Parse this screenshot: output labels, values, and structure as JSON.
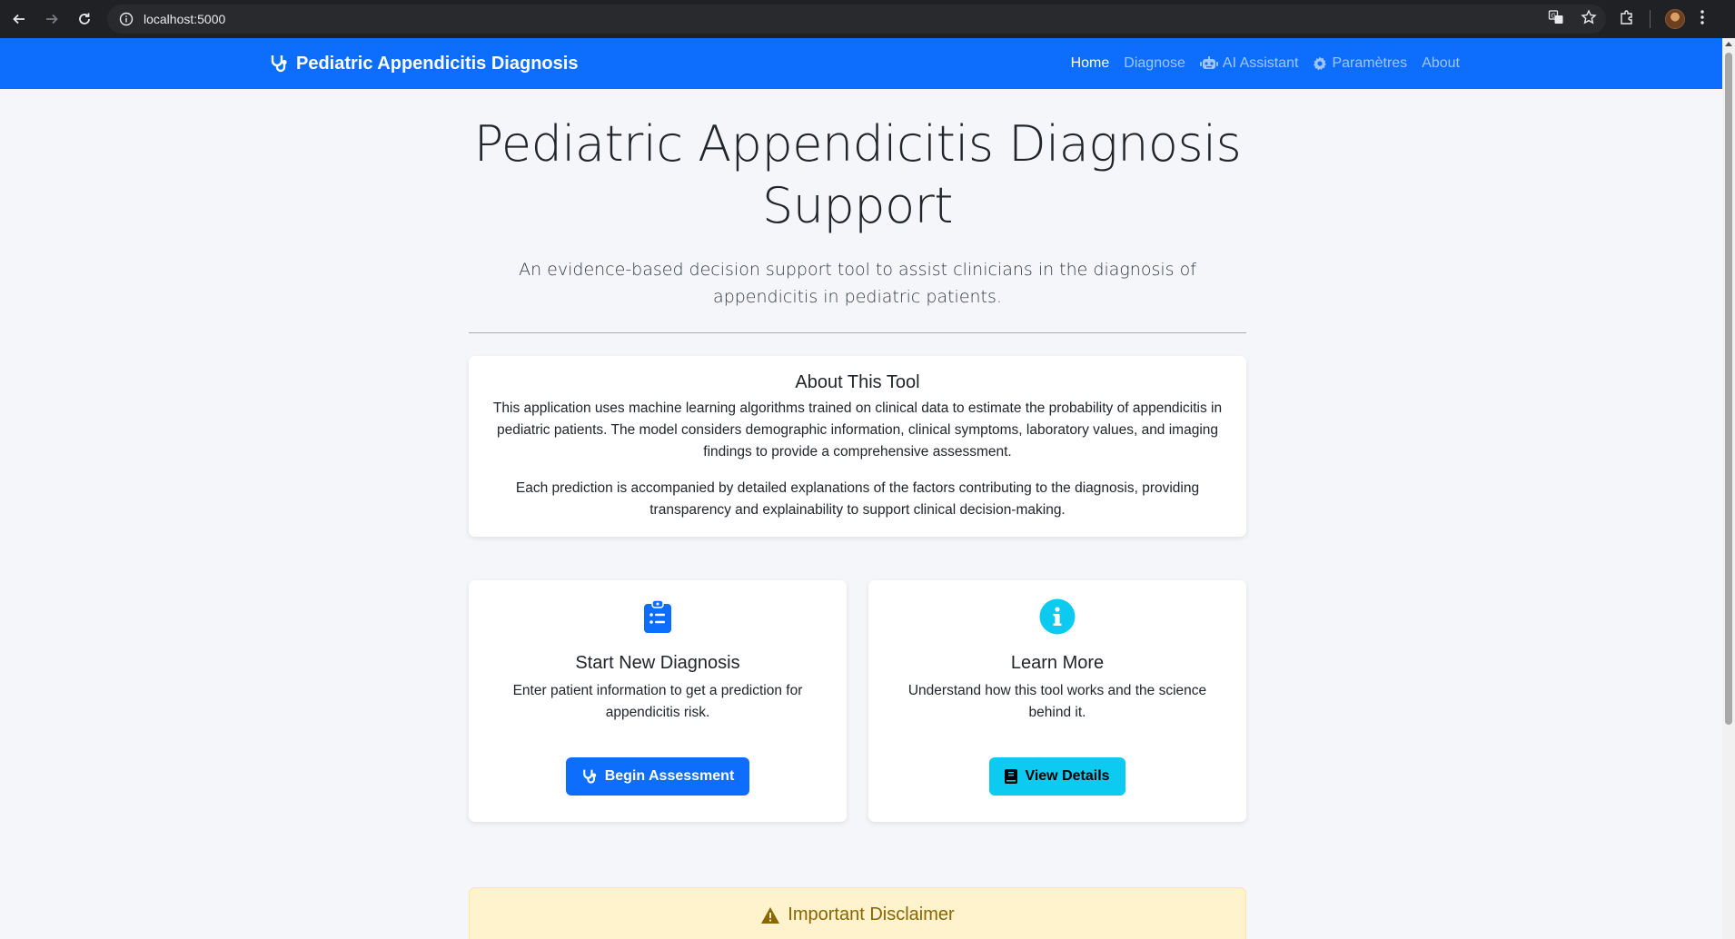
{
  "browser": {
    "url": "localhost:5000"
  },
  "navbar": {
    "brand": "Pediatric Appendicitis Diagnosis",
    "links": [
      {
        "label": "Home",
        "active": true
      },
      {
        "label": "Diagnose",
        "active": false
      },
      {
        "label": "AI Assistant",
        "icon": "robot-icon",
        "active": false
      },
      {
        "label": "Paramètres",
        "icon": "gear-icon",
        "active": false
      },
      {
        "label": "About",
        "active": false
      }
    ]
  },
  "hero": {
    "title_line1": "Pediatric Appendicitis Diagnosis",
    "title_line2": "Support",
    "lead": "An evidence-based decision support tool to assist clinicians in the diagnosis of appendicitis in pediatric patients."
  },
  "about": {
    "title": "About This Tool",
    "paragraph1": "This application uses machine learning algorithms trained on clinical data to estimate the probability of appendicitis in pediatric patients. The model considers demographic information, clinical symptoms, laboratory values, and imaging findings to provide a comprehensive assessment.",
    "paragraph2": "Each prediction is accompanied by detailed explanations of the factors contributing to the diagnosis, providing transparency and explainability to support clinical decision-making."
  },
  "cards": [
    {
      "icon": "clipboard-list-icon",
      "title": "Start New Diagnosis",
      "text": "Enter patient information to get a prediction for appendicitis risk.",
      "button": "Begin Assessment",
      "button_icon": "stethoscope-icon"
    },
    {
      "icon": "info-circle-icon",
      "title": "Learn More",
      "text": "Understand how this tool works and the science behind it.",
      "button": "View Details",
      "button_icon": "book-icon"
    }
  ],
  "disclaimer": {
    "title": "Important Disclaimer",
    "icon": "warning-icon"
  },
  "colors": {
    "primary": "#0d6efd",
    "info": "#0dcaf0",
    "warning_bg": "#fff3cd",
    "warning_text": "#8a6500",
    "page_bg": "#f5f6f9"
  }
}
